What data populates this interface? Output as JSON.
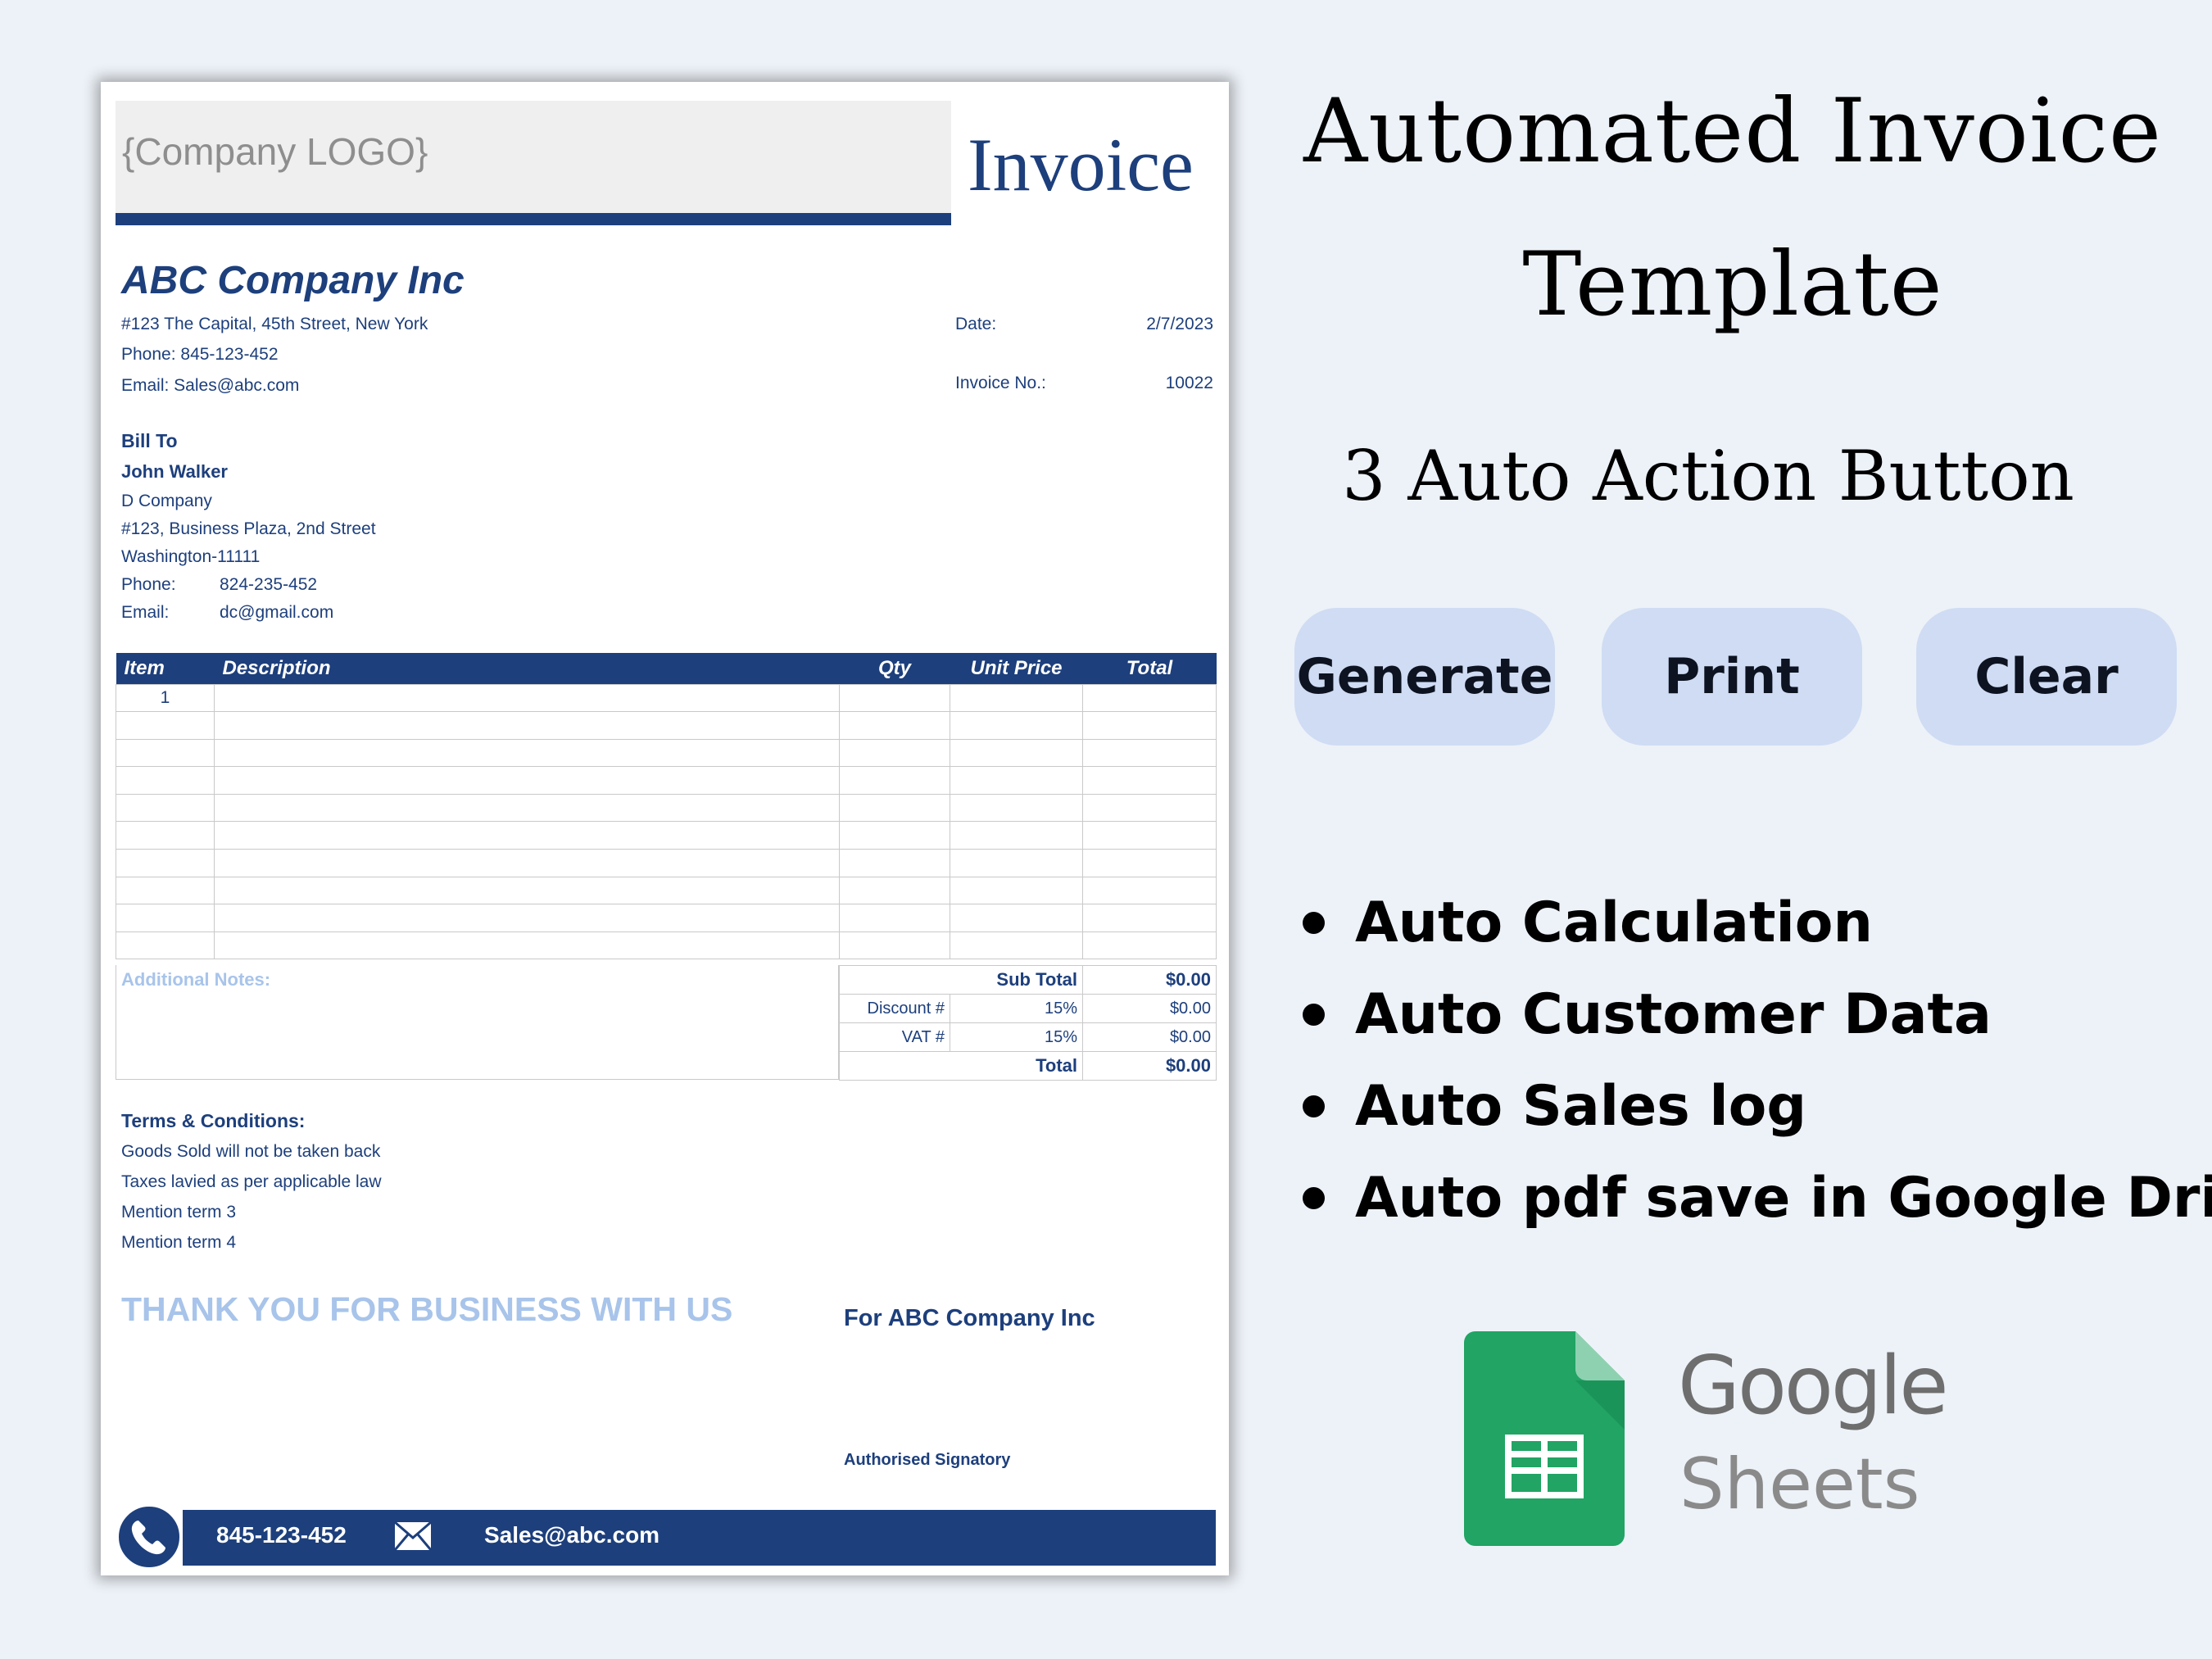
{
  "invoice": {
    "logo_placeholder": "{Company LOGO}",
    "title": "Invoice",
    "company": {
      "name": "ABC Company Inc",
      "address": "#123 The Capital, 45th Street, New York",
      "phone": "Phone: 845-123-452",
      "email": "Email: Sales@abc.com"
    },
    "meta": {
      "date_label": "Date:",
      "date_value": "2/7/2023",
      "invoice_no_label": "Invoice No.:",
      "invoice_no_value": "10022"
    },
    "bill_to": {
      "heading": "Bill To",
      "name": "John Walker",
      "company": "D Company",
      "address": "#123, Business Plaza, 2nd Street",
      "city": "Washington-11111",
      "phone_label": "Phone:",
      "phone_value": "824-235-452",
      "email_label": "Email:",
      "email_value": "dc@gmail.com"
    },
    "table": {
      "headers": [
        "Item",
        "Description",
        "Qty",
        "Unit Price",
        "Total"
      ],
      "first_item_no": "1"
    },
    "notes_label": "Additional Notes:",
    "totals": {
      "subtotal_label": "Sub Total",
      "subtotal_value": "$0.00",
      "discount_label": "Discount #",
      "discount_rate": "15%",
      "discount_value": "$0.00",
      "vat_label": "VAT #",
      "vat_rate": "15%",
      "vat_value": "$0.00",
      "total_label": "Total",
      "total_value": "$0.00"
    },
    "terms": {
      "heading": "Terms & Conditions:",
      "lines": [
        "Goods Sold will not be taken back",
        "Taxes lavied as per applicable law",
        "Mention term 3",
        "Mention term 4"
      ]
    },
    "thank_you": "THANK YOU FOR BUSINESS WITH US",
    "for_company": "For ABC Company Inc",
    "signatory": "Authorised Signatory",
    "footer": {
      "phone": "845-123-452",
      "email": "Sales@abc.com"
    }
  },
  "promo": {
    "title_line1": "Automated Invoice",
    "title_line2": "Template",
    "subtitle": "3 Auto Action Button",
    "buttons": [
      "Generate",
      "Print",
      "Clear"
    ],
    "features": [
      "Auto Calculation",
      "Auto Customer Data",
      "Auto Sales log",
      "Auto pdf save in Google Drive"
    ],
    "brand_google": "Google",
    "brand_sheets": "Sheets"
  },
  "colors": {
    "navy": "#1d3f7c",
    "light_blue": "#a8c4ea",
    "button_bg": "#cfdcf3",
    "background": "#edf2f8",
    "sheets_green": "#21a464"
  }
}
